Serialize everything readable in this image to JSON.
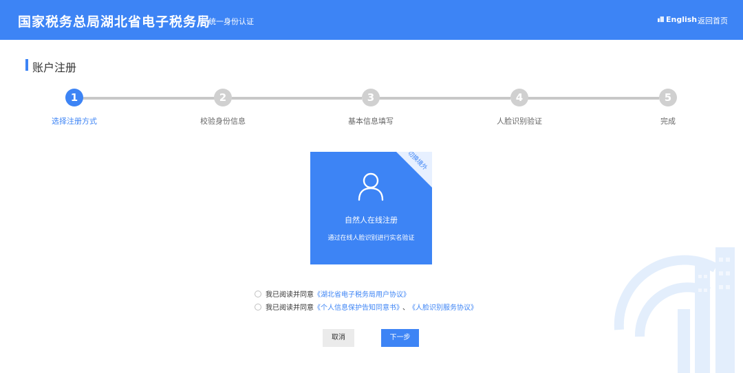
{
  "header": {
    "brand": "国家税务总局湖北省电子税务局",
    "subtitle": "统一身份认证",
    "language": "English",
    "home_link": "返回首页"
  },
  "section": {
    "title": "账户注册"
  },
  "steps": [
    {
      "number": "1",
      "label": "选择注册方式",
      "active": true
    },
    {
      "number": "2",
      "label": "校验身份信息",
      "active": false
    },
    {
      "number": "3",
      "label": "基本信息填写",
      "active": false
    },
    {
      "number": "4",
      "label": "人脸识别验证",
      "active": false
    },
    {
      "number": "5",
      "label": "完成",
      "active": false
    }
  ],
  "card": {
    "corner_label": "切换境外",
    "title": "自然人在线注册",
    "description": "通过在线人脸识别进行实名验证"
  },
  "agreements": [
    {
      "prefix": "我已阅读并同意",
      "links": [
        "《湖北省电子税务局用户协议》"
      ],
      "separator": ""
    },
    {
      "prefix": "我已阅读并同意",
      "links": [
        "《个人信息保护告知同意书》",
        "《人脸识别服务协议》"
      ],
      "separator": "、"
    }
  ],
  "buttons": {
    "cancel": "取消",
    "next": "下一步"
  },
  "colors": {
    "primary": "#3d84f5",
    "inactive_step": "#d0d0d0"
  }
}
